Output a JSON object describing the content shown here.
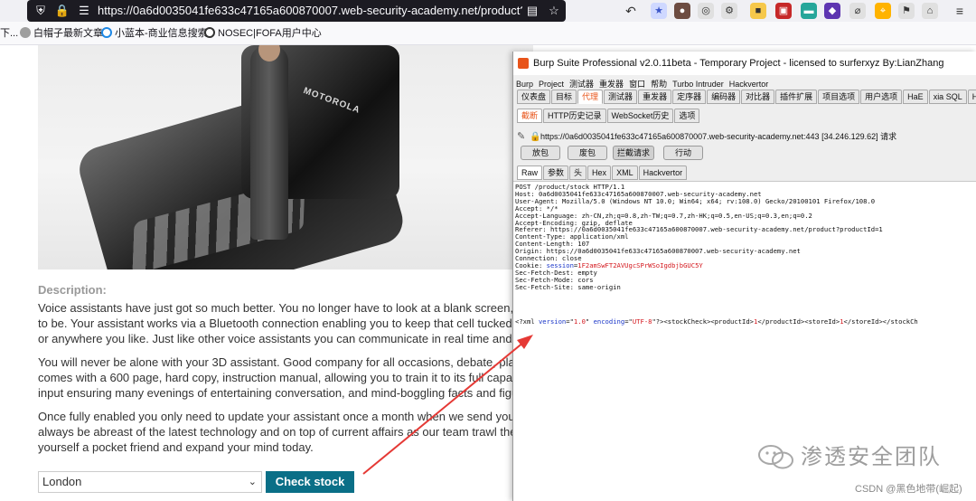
{
  "browser": {
    "url": "https://0a6d0035041fe633c47165a600870007.web-security-academy.net/product?productId=1"
  },
  "bookmarks": [
    {
      "label": "下..."
    },
    {
      "label": "白帽子最新文章"
    },
    {
      "label": "小蓝本-商业信息搜索"
    },
    {
      "label": "NOSEC|FOFA用户中心"
    }
  ],
  "product": {
    "image_brand": "MOTOROLA",
    "description_label": "Description:",
    "paragraphs": [
      [
        "Voice assistants have just got so much better. You no longer have to look at a blank screen, you",
        "to be. Your assistant works via a Bluetooth connection enabling you to keep that cell tucked awa",
        "or anywhere you like. Just like other voice assistants you can communicate in real time and ask"
      ],
      [
        "You will never be alone with your 3D assistant. Good company for all occasions, debate, play pu",
        "comes with a 600 page, hard copy, instruction manual, allowing you to train it to its full capacity.",
        "input ensuring many evenings of entertaining conversation, and mind-boggling facts and figures"
      ],
      [
        "Once fully enabled you only need to update your assistant once a month when we send you the",
        "always be abreast of the latest technology and on top of current affairs as our team trawl the net",
        "yourself a pocket friend and expand your mind today."
      ]
    ],
    "store_selected": "London",
    "check_stock_label": "Check stock"
  },
  "burp": {
    "title": "Burp Suite Professional v2.0.11beta - Temporary Project - licensed to surferxyz By:LianZhang",
    "menu": [
      "Burp",
      "Project",
      "测试器",
      "重发器",
      "窗口",
      "帮助",
      "Turbo Intruder",
      "Hackvertor"
    ],
    "tabs": [
      "仪表盘",
      "目标",
      "代理",
      "测试器",
      "重发器",
      "定序器",
      "编码器",
      "对比器",
      "插件扩展",
      "项目选项",
      "用户选项",
      "HaE",
      "xia SQL",
      "Hackvertor"
    ],
    "active_tab": "代理",
    "sub_tabs": [
      "截断",
      "HTTP历史记录",
      "WebSocket历史",
      "选项"
    ],
    "active_sub_tab": "截断",
    "request_info": "https://0a6d0035041fe633c47165a600870007.web-security-academy.net:443  [34.246.129.62] 请求",
    "actions": [
      "放包",
      "废包",
      "拦截请求",
      "行动"
    ],
    "view_tabs": [
      "Raw",
      "参数",
      "头",
      "Hex",
      "XML",
      "Hackvertor"
    ],
    "active_view_tab": "Raw",
    "request_lines": [
      "POST /product/stock HTTP/1.1",
      "Host: 0a6d0035041fe633c47165a600870007.web-security-academy.net",
      "User-Agent: Mozilla/5.0 (Windows NT 10.0; Win64; x64; rv:108.0) Gecko/20100101 Firefox/108.0",
      "Accept: */*",
      "Accept-Language: zh-CN,zh;q=0.8,zh-TW;q=0.7,zh-HK;q=0.5,en-US;q=0.3,en;q=0.2",
      "Accept-Encoding: gzip, deflate",
      "Referer: https://0a6d0035041fe633c47165a600870007.web-security-academy.net/product?productId=1",
      "Content-Type: application/xml",
      "Content-Length: 107",
      "Origin: https://0a6d0035041fe633c47165a600870007.web-security-academy.net",
      "Connection: close"
    ],
    "cookie_key": "Cookie: ",
    "cookie_name": "session",
    "cookie_eq": "=",
    "cookie_value": "1F2amSwFT2AVUgcSPrWSoIgdbjbGUC5Y",
    "request_lines_after": [
      "Sec-Fetch-Dest: empty",
      "Sec-Fetch-Mode: cors",
      "Sec-Fetch-Site: same-origin"
    ],
    "xml_body": {
      "p1": "<?xml ",
      "attr1": "version",
      "p2": "=\"",
      "v1": "1.0",
      "p3": "\" ",
      "attr2": "encoding",
      "p4": "=\"",
      "v2": "UTF-8",
      "p5": "\"?><stockCheck><productId>",
      "pid": "1",
      "p6": "</productId><storeId>",
      "sid": "1",
      "p7": "</storeId></stockCh"
    }
  },
  "watermark": {
    "title": "渗透安全团队",
    "csdn": "CSDN @黑色地带(崛起)"
  },
  "colors": {
    "check_button": "#0a6f87",
    "burp_orange": "#e8541a",
    "annotation_arrow": "#e53935"
  }
}
